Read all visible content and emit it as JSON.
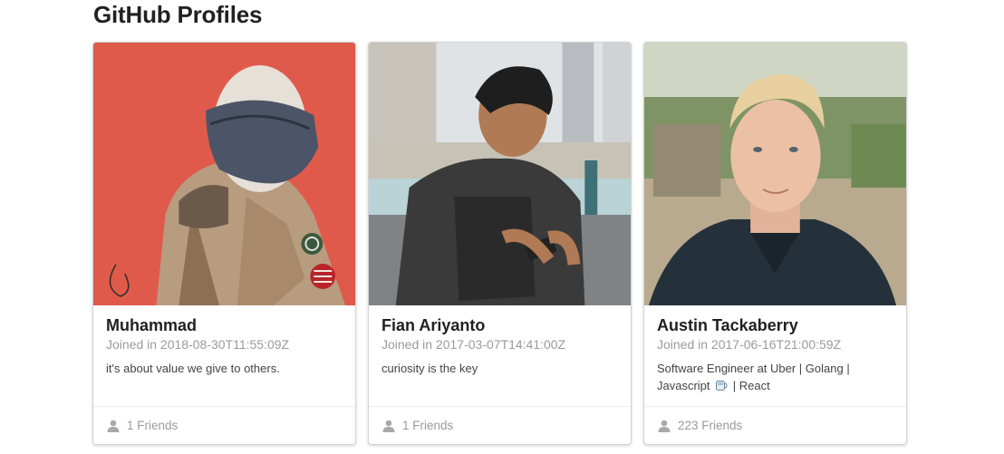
{
  "page": {
    "title": "GitHub Profiles"
  },
  "profiles": [
    {
      "name": "Muhammad",
      "joined": "Joined in 2018-08-30T11:55:09Z",
      "bio": "it's about value we give to others.",
      "friends": "1 Friends",
      "photo": "illustrated-helmet-soldier-avatar",
      "bg_color": "#e05a4c"
    },
    {
      "name": "Fian Ariyanto",
      "joined": "Joined in 2017-03-07T14:41:00Z",
      "bio": "curiosity is the key",
      "friends": "1 Friends",
      "photo": "young-man-looking-at-phone-photo",
      "bg_color": "#d9dde0"
    },
    {
      "name": "Austin Tackaberry",
      "joined": "Joined in 2017-06-16T21:00:59Z",
      "bio_part1": "Software Engineer at Uber | Golang |",
      "bio_part2": "Javascript",
      "bio_part3": "| React",
      "friends": "223 Friends",
      "photo": "blond-man-portrait-photo",
      "bg_color": "#8fa07a"
    }
  ]
}
